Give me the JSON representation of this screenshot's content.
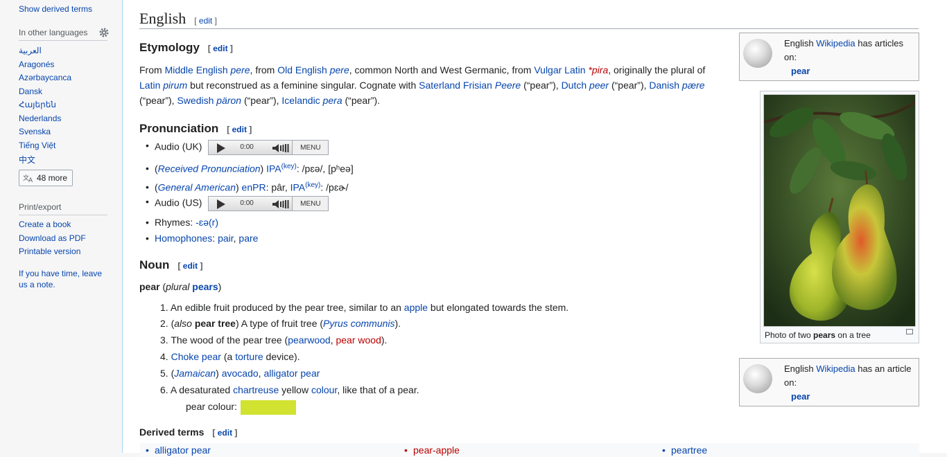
{
  "sidebar": {
    "show_derived": "Show derived terms",
    "other_languages": "In other languages",
    "languages": [
      "العربية",
      "Aragonés",
      "Azərbaycanca",
      "Dansk",
      "Հայերեն",
      "Nederlands",
      "Svenska",
      "Tiếng Việt",
      "中文"
    ],
    "more_button": "48 more",
    "print_export": "Print/export",
    "print_links": [
      "Create a book",
      "Download as PDF",
      "Printable version"
    ],
    "note": "If you have time, leave us a note."
  },
  "page": {
    "title": "English",
    "edit_label": "edit"
  },
  "etymology": {
    "heading": "Etymology",
    "line1": {
      "t1": "From ",
      "l1": "Middle English",
      "t2": " ",
      "l2": "pere",
      "t3": ", from ",
      "l3": "Old English",
      "t4": " ",
      "l4": "pere",
      "t5": ", common North and West Germanic, from ",
      "l5": "Vulgar Latin",
      "t6": " ",
      "r1": "*pira",
      "t7": ", originally the plural of"
    },
    "line2": {
      "l1": "Latin",
      "t1": " ",
      "l2": "pirum",
      "t2": " but reconstrued as a feminine singular. Cognate with ",
      "l3": "Saterland Frisian",
      "t3": " ",
      "l4": "Peere",
      "t4": " (“pear”), ",
      "l5": "Dutch",
      "t5": " ",
      "l6": "peer",
      "t6": " (“pear”), ",
      "l7": "Danish",
      "t7": " ",
      "l8": "pære"
    },
    "line3": {
      "t1": "(“pear”), ",
      "l1": "Swedish",
      "t2": " ",
      "l2": "päron",
      "t3": " (“pear”), ",
      "l3": "Icelandic",
      "t4": " ",
      "l4": "pera",
      "t5": " (“pear”)."
    }
  },
  "pronunciation": {
    "heading": "Pronunciation",
    "audio_uk": "Audio (UK)",
    "audio_us": "Audio (US)",
    "player_time": "0:00",
    "player_menu": "MENU",
    "rp": {
      "open": "(",
      "label": "Received Pronunciation",
      "close": ") ",
      "ipa": "IPA",
      "key": "(key)",
      "value": ": /pɛə/, [pʰeə]"
    },
    "ga": {
      "open": "(",
      "label": "General American",
      "close": ") ",
      "enpr": "enPR",
      "enpr_val": ": pâr, ",
      "ipa": "IPA",
      "key": "(key)",
      "value": ": /pɛɚ/"
    },
    "rhymes_label": "Rhymes: ",
    "rhymes_link": "-ɛə(r)",
    "homophones_label": "Homophones",
    "homophones_sep": ": ",
    "homophone1": "pair",
    "homophone_comma": ", ",
    "homophone2": "pare"
  },
  "noun": {
    "heading": "Noun",
    "head_word": "pear",
    "plural_open": " (",
    "plural_label": "plural",
    "plural_space": " ",
    "plural_form": "pears",
    "plural_close": ")",
    "senses": [
      {
        "n": "1.",
        "t1": "An edible fruit produced by the pear tree, similar to an ",
        "l1": "apple",
        "t2": " but elongated towards the stem."
      },
      {
        "n": "2.",
        "t1": "(",
        "i1": "also",
        "t2": " ",
        "b1": "pear tree",
        "t3": ") A type of fruit tree (",
        "l1": "Pyrus communis",
        "t4": ")."
      },
      {
        "n": "3.",
        "t1": "The wood of the pear tree (",
        "l1": "pearwood",
        "t2": ", ",
        "r1": "pear wood",
        "t3": ")."
      },
      {
        "n": "4.",
        "l1": "Choke pear",
        "t1": " (a ",
        "l2": "torture",
        "t2": " device)."
      },
      {
        "n": "5.",
        "t1": "(",
        "l1": "Jamaican",
        "t2": ") ",
        "l2": "avocado",
        "t3": ", ",
        "l3": "alligator pear"
      },
      {
        "n": "6.",
        "t1": "A desaturated ",
        "l1": "chartreuse",
        "t2": " yellow ",
        "l2": "colour",
        "t3": ", like that of a pear."
      }
    ],
    "colour_label": "pear colour:",
    "swatch_color": "#d1e231"
  },
  "derived": {
    "heading": "Derived terms",
    "items": [
      "alligator pear",
      "pear-apple",
      "peartree"
    ]
  },
  "wikipedia_box1": {
    "t1": "English ",
    "link": "Wikipedia",
    "t2": " has articles on:",
    "article": "pear"
  },
  "wikipedia_box2": {
    "t1": "English ",
    "link": "Wikipedia",
    "t2": " has an article on:",
    "article": "pear"
  },
  "thumb": {
    "caption_t1": "Photo of two ",
    "caption_b": "pears",
    "caption_t2": " on a tree"
  }
}
